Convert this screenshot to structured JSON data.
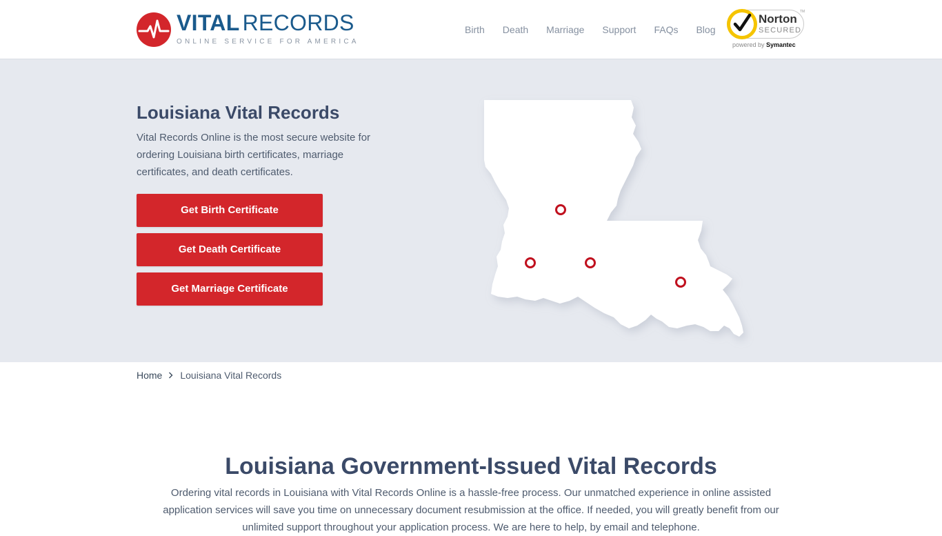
{
  "header": {
    "logo": {
      "word1": "VITAL",
      "word2": "RECORDS",
      "tagline": "ONLINE SERVICE FOR AMERICA"
    },
    "nav": [
      {
        "label": "Birth"
      },
      {
        "label": "Death"
      },
      {
        "label": "Marriage"
      },
      {
        "label": "Support"
      },
      {
        "label": "FAQs"
      },
      {
        "label": "Blog"
      }
    ],
    "norton": {
      "name": "Norton",
      "secured": "SECURED",
      "powered": "powered by",
      "brand": "Symantec",
      "tm": "TM"
    }
  },
  "hero": {
    "title": "Louisiana Vital Records",
    "description": "Vital Records Online is the most secure website for ordering Louisiana birth certificates, marriage certificates, and death certificates.",
    "buttons": [
      {
        "label": "Get Birth Certificate"
      },
      {
        "label": "Get Death Certificate"
      },
      {
        "label": "Get Marriage Certificate"
      }
    ]
  },
  "breadcrumb": {
    "home": "Home",
    "current": "Louisiana Vital Records"
  },
  "section": {
    "title": "Louisiana Government-Issued Vital Records",
    "text": "Ordering vital records in Louisiana with Vital Records Online is a hassle-free process. Our unmatched experience in online assisted application services will save you time on unnecessary document resubmission at the office. If needed, you will greatly benefit from our unlimited support throughout your application process. We are here to help, by email and telephone."
  },
  "colors": {
    "brand_red": "#d3262b",
    "brand_blue": "#1a5a8c",
    "hero_bg": "#e6e9ef",
    "marker": "#c0101e"
  },
  "icons": [
    "heartbeat-logo-icon",
    "norton-check-icon",
    "chevron-right-icon",
    "map-marker-icon"
  ]
}
